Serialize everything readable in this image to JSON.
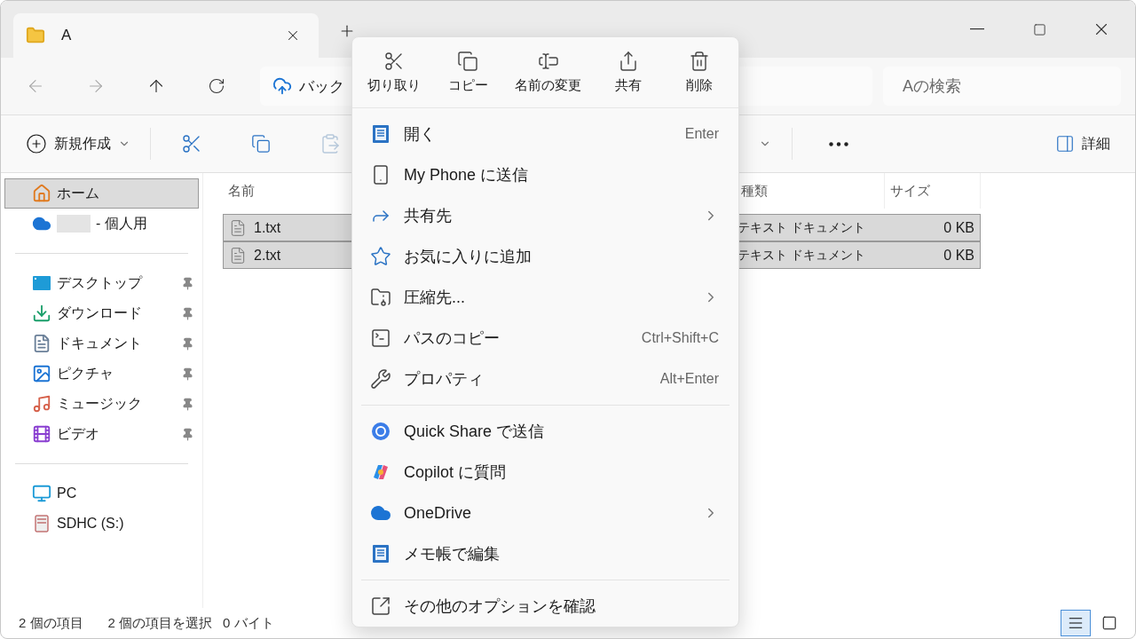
{
  "window": {
    "tab_title": "A",
    "address": "バック",
    "search_placeholder": "Aの検索"
  },
  "toolbar": {
    "new_label": "新規作成",
    "details_label": "詳細"
  },
  "sidebar": {
    "groups": [
      [
        {
          "label": "ホーム",
          "kind": "home",
          "selected": true,
          "pinned": false,
          "redacted": false
        },
        {
          "label": "- 個人用",
          "kind": "cloud",
          "selected": false,
          "pinned": false,
          "redacted": true
        }
      ],
      [
        {
          "label": "デスクトップ",
          "kind": "desktop",
          "selected": false,
          "pinned": true,
          "redacted": false
        },
        {
          "label": "ダウンロード",
          "kind": "download",
          "selected": false,
          "pinned": true,
          "redacted": false
        },
        {
          "label": "ドキュメント",
          "kind": "document",
          "selected": false,
          "pinned": true,
          "redacted": false
        },
        {
          "label": "ピクチャ",
          "kind": "picture",
          "selected": false,
          "pinned": true,
          "redacted": false
        },
        {
          "label": "ミュージック",
          "kind": "music",
          "selected": false,
          "pinned": true,
          "redacted": false
        },
        {
          "label": "ビデオ",
          "kind": "video",
          "selected": false,
          "pinned": true,
          "redacted": false
        }
      ],
      [
        {
          "label": "PC",
          "kind": "pc",
          "selected": false,
          "pinned": false,
          "redacted": false
        },
        {
          "label": "SDHC (S:)",
          "kind": "sd",
          "selected": false,
          "pinned": false,
          "redacted": false
        }
      ]
    ]
  },
  "columns": [
    "名前",
    "種類",
    "サイズ"
  ],
  "files": [
    {
      "name": "1.txt",
      "type": "テキスト ドキュメント",
      "size": "0 KB",
      "selected": true
    },
    {
      "name": "2.txt",
      "type": "テキスト ドキュメント",
      "size": "0 KB",
      "selected": true
    }
  ],
  "status": {
    "count": "2 個の項目",
    "selection": "2 個の項目を選択",
    "bytes": "0 バイト"
  },
  "view_buttons": [
    {
      "kind": "details",
      "selected": true
    },
    {
      "kind": "tiles",
      "selected": false
    }
  ],
  "context_menu": {
    "actions": [
      {
        "kind": "cut",
        "label": "切り取り"
      },
      {
        "kind": "copy",
        "label": "コピー"
      },
      {
        "kind": "rename",
        "label": "名前の変更"
      },
      {
        "kind": "share",
        "label": "共有"
      },
      {
        "kind": "delete",
        "label": "削除"
      }
    ],
    "groups": [
      [
        {
          "kind": "notepad",
          "label": "開く",
          "shortcut": "Enter",
          "submenu": false
        },
        {
          "kind": "phone",
          "label": "My Phone に送信",
          "submenu": false
        },
        {
          "kind": "share",
          "label": "共有先",
          "submenu": true
        },
        {
          "kind": "star",
          "label": "お気に入りに追加",
          "submenu": false
        },
        {
          "kind": "archive",
          "label": "圧縮先...",
          "submenu": true
        },
        {
          "kind": "path",
          "label": "パスのコピー",
          "shortcut": "Ctrl+Shift+C",
          "submenu": false
        },
        {
          "kind": "wrench",
          "label": "プロパティ",
          "shortcut": "Alt+Enter",
          "submenu": false
        }
      ],
      [
        {
          "kind": "quickshare",
          "label": "Quick Share で送信",
          "submenu": false
        },
        {
          "kind": "copilot",
          "label": "Copilot に質問",
          "submenu": false
        },
        {
          "kind": "cloud",
          "label": "OneDrive",
          "submenu": true
        },
        {
          "kind": "notepad",
          "label": "メモ帳で編集",
          "submenu": false
        }
      ],
      [
        {
          "kind": "more",
          "label": "その他のオプションを確認",
          "submenu": false
        }
      ]
    ]
  }
}
